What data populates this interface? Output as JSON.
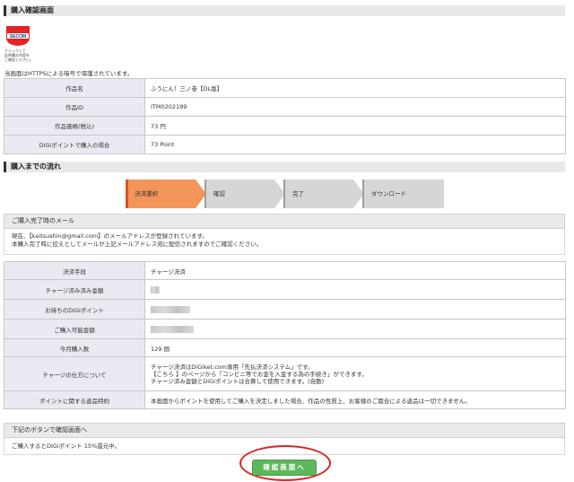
{
  "purchase_confirm": {
    "title": "購入確認画面"
  },
  "seal": {
    "brand": "SECOM",
    "caption_line1": "クリックして",
    "caption_line2": "証明書の内容を",
    "caption_line3": "ご確認ください。"
  },
  "https_note": "当画面はHTTPSによる暗号で保護されています。",
  "product_table": [
    {
      "label": "作品名",
      "value": "ふうにん！三ノ巻【DL版】"
    },
    {
      "label": "作品ID",
      "value": "ITM0202199"
    },
    {
      "label": "作品価格(税込)",
      "value": "73 円"
    },
    {
      "label": "DiGiポイントで購入の場合",
      "value": "73 Point"
    }
  ],
  "flow": {
    "title": "購入までの流れ",
    "steps": [
      "決済選択",
      "確認",
      "完了",
      "ダウンロード"
    ],
    "active_color": "#f4955a",
    "inactive_color": "#d6d6d6"
  },
  "mail_panel": {
    "title": "ご購入完了時のメール",
    "line1": "現在、【kaitsushin@gmail.com】のメールアドレスが登録されています。",
    "line2": "本購入完了時に控えとしてメールが上記メールアドレス宛に配信されますのでご確認ください。"
  },
  "payment_table": {
    "rows": [
      {
        "label": "決済手段",
        "value": "チャージ決済"
      },
      {
        "label": "チャージ済み済み金額",
        "value": ""
      },
      {
        "label": "お持ちのDiGiポイント",
        "value": ""
      },
      {
        "label": "ご購入可能金額",
        "value": ""
      },
      {
        "label": "今月購入数",
        "value": "129 個"
      }
    ],
    "charge_method": {
      "label": "チャージの仕方について",
      "line1": "チャージ決済はDiGiket.com専用「先払決済システム」です。",
      "line2": "【こちら 】のページから「コンビニ等でお金を入金する為の手続き」ができます。",
      "line3": "チャージ済み金額とDiGiポイントは合算して使用できます。(自動)"
    },
    "points_policy": {
      "label": "ポイントに関する返品特約",
      "value": "本画面からポイントを使用してご購入を決定しました場合、作品の性質上、お客様のご都合による返品は一切できません。"
    }
  },
  "bottom_panel": {
    "title": "下記のボタンで確認画面へ",
    "note": "ご購入するとDiGiポイント 15%還元中。"
  },
  "confirm_button": {
    "label": "確認画面へ",
    "color": "#5bb85b"
  },
  "highlight_color": "#e02020"
}
